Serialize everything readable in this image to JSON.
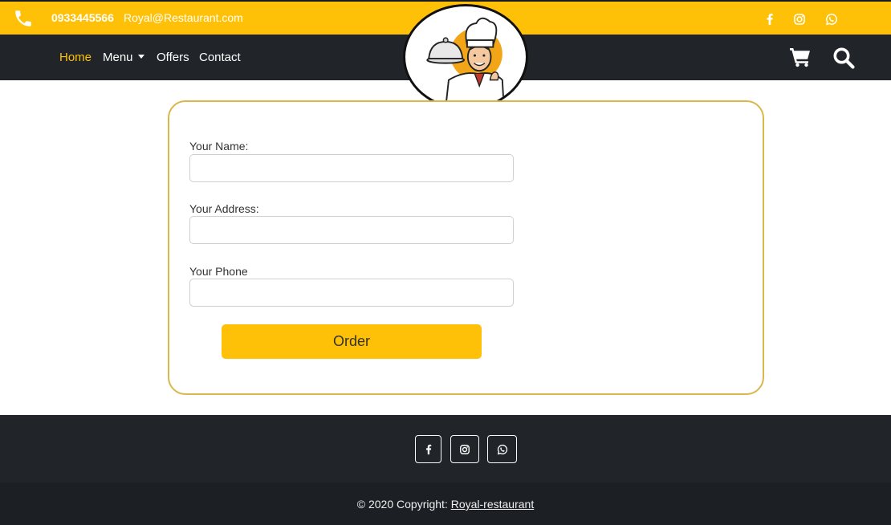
{
  "topbar": {
    "phone": "0933445566",
    "email": "Royal@Restaurant.com",
    "social_icons": [
      "facebook-icon",
      "instagram-icon",
      "whatsapp-icon"
    ]
  },
  "nav": {
    "items": [
      {
        "label": "Home",
        "active": true
      },
      {
        "label": "Menu",
        "dropdown": true
      },
      {
        "label": "Offers"
      },
      {
        "label": "Contact"
      }
    ],
    "icons": [
      "cart-icon",
      "search-icon"
    ]
  },
  "form": {
    "name_label": "Your Name:",
    "name_value": "",
    "address_label": "Your Address:",
    "address_value": "",
    "phone_label": "Your Phone",
    "phone_value": "",
    "submit_label": "Order"
  },
  "footer": {
    "social_icons": [
      "facebook-icon",
      "instagram-icon",
      "whatsapp-icon"
    ],
    "copyright_text": "© 2020 Copyright: ",
    "copyright_link": "Royal-restaurant"
  },
  "colors": {
    "accent": "#ffc107",
    "dark": "#212529",
    "card_border": "#d9b74a"
  }
}
